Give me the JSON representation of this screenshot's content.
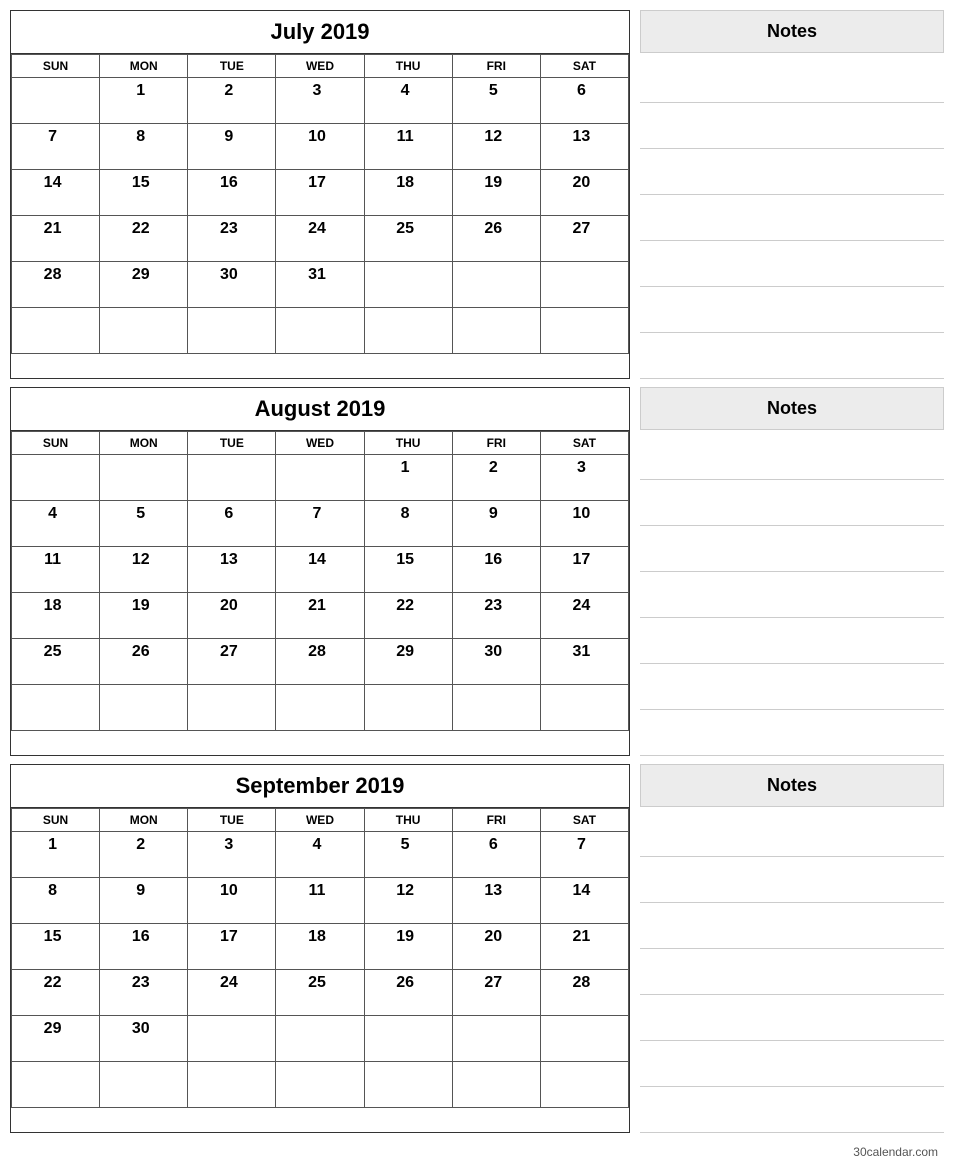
{
  "months": [
    {
      "title": "July 2019",
      "notes_label": "Notes",
      "days_header": [
        "SUN",
        "MON",
        "TUE",
        "WED",
        "THU",
        "FRI",
        "SAT"
      ],
      "weeks": [
        [
          "",
          "1",
          "2",
          "3",
          "4",
          "5",
          "6"
        ],
        [
          "7",
          "8",
          "9",
          "10",
          "11",
          "12",
          "13"
        ],
        [
          "14",
          "15",
          "16",
          "17",
          "18",
          "19",
          "20"
        ],
        [
          "21",
          "22",
          "23",
          "24",
          "25",
          "26",
          "27"
        ],
        [
          "28",
          "29",
          "30",
          "31",
          "",
          "",
          ""
        ],
        [
          "",
          "",
          "",
          "",
          "",
          "",
          ""
        ]
      ],
      "note_lines": 7
    },
    {
      "title": "August 2019",
      "notes_label": "Notes",
      "days_header": [
        "SUN",
        "MON",
        "TUE",
        "WED",
        "THU",
        "FRI",
        "SAT"
      ],
      "weeks": [
        [
          "",
          "",
          "",
          "",
          "1",
          "2",
          "3"
        ],
        [
          "4",
          "5",
          "6",
          "7",
          "8",
          "9",
          "10"
        ],
        [
          "11",
          "12",
          "13",
          "14",
          "15",
          "16",
          "17"
        ],
        [
          "18",
          "19",
          "20",
          "21",
          "22",
          "23",
          "24"
        ],
        [
          "25",
          "26",
          "27",
          "28",
          "29",
          "30",
          "31"
        ],
        [
          "",
          "",
          "",
          "",
          "",
          "",
          ""
        ]
      ],
      "note_lines": 7
    },
    {
      "title": "September 2019",
      "notes_label": "Notes",
      "days_header": [
        "SUN",
        "MON",
        "TUE",
        "WED",
        "THU",
        "FRI",
        "SAT"
      ],
      "weeks": [
        [
          "1",
          "2",
          "3",
          "4",
          "5",
          "6",
          "7"
        ],
        [
          "8",
          "9",
          "10",
          "11",
          "12",
          "13",
          "14"
        ],
        [
          "15",
          "16",
          "17",
          "18",
          "19",
          "20",
          "21"
        ],
        [
          "22",
          "23",
          "24",
          "25",
          "26",
          "27",
          "28"
        ],
        [
          "29",
          "30",
          "",
          "",
          "",
          "",
          ""
        ],
        [
          "",
          "",
          "",
          "",
          "",
          "",
          ""
        ]
      ],
      "note_lines": 7
    }
  ],
  "footer": {
    "text": "30calendar.com"
  }
}
